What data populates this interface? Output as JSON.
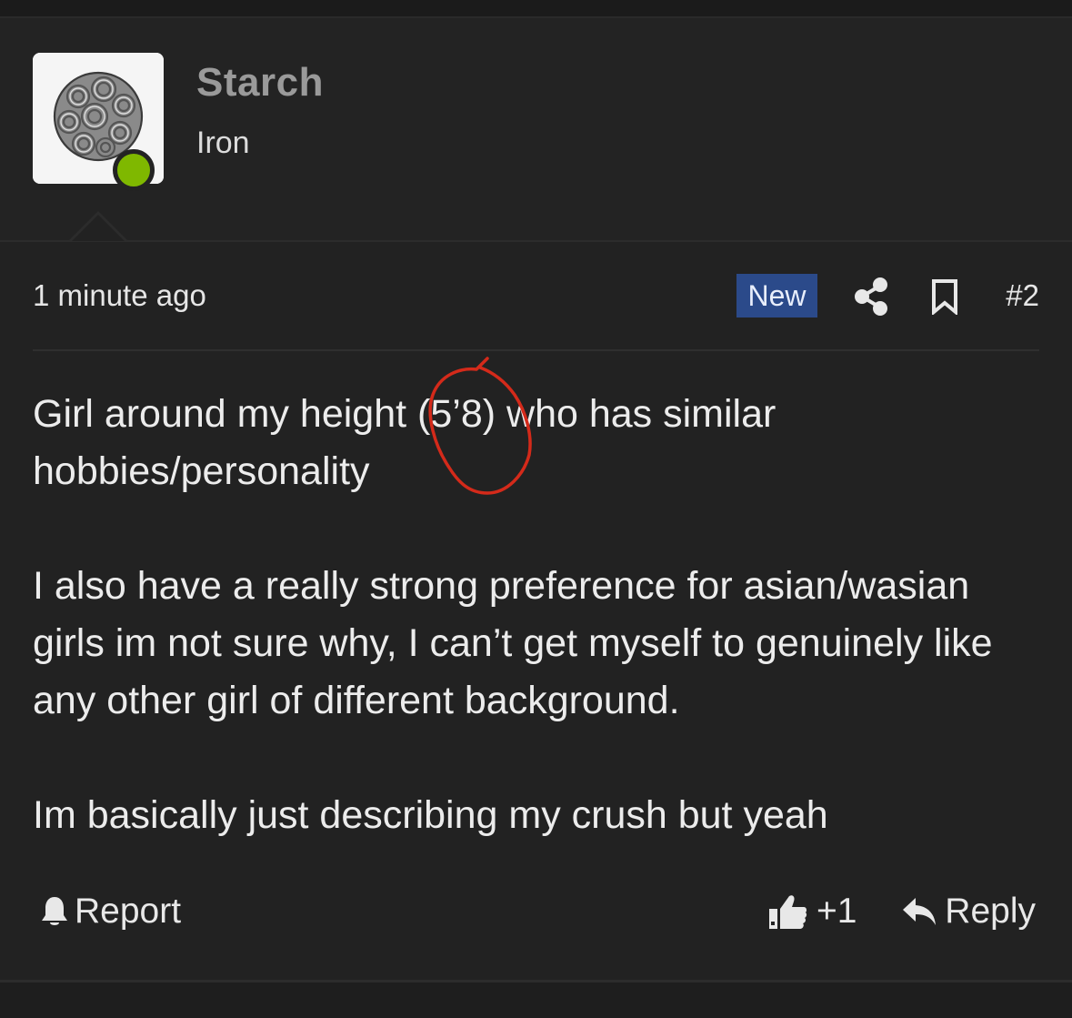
{
  "author": {
    "name": "Starch",
    "title": "Iron",
    "status": "online",
    "status_color": "#7fb800"
  },
  "meta": {
    "timestamp": "1 minute ago",
    "badge": "New",
    "badge_color": "#2b4a8a",
    "post_number": "#2",
    "share_icon": "share-icon",
    "bookmark_icon": "bookmark-icon"
  },
  "post": {
    "paragraph_1_before": "Girl around my height ",
    "paragraph_1_circled": "(5’8)",
    "paragraph_1_after": " who has similar hobbies/personality",
    "paragraph_2": "I also have a really strong preference for asian/wasian girls im not sure why, I can’t get myself to genuinely like any other girl of different background.",
    "paragraph_3": "Im basically just describing my crush but yeah",
    "annotation_color": "#d42a1a"
  },
  "actions": {
    "report_label": "Report",
    "like_count": "+1",
    "reply_label": "Reply"
  }
}
